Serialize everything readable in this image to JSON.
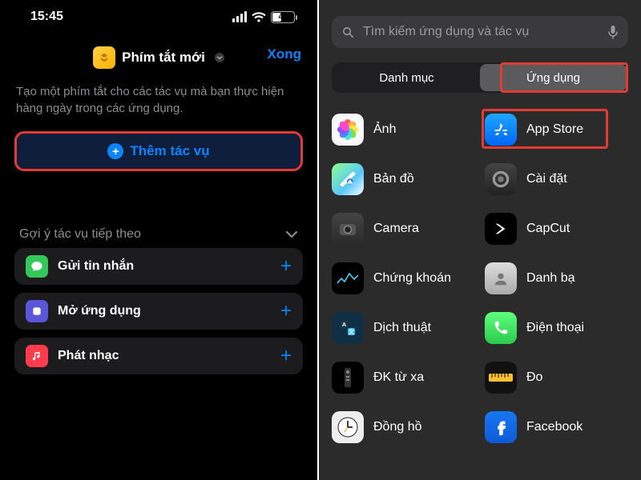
{
  "left": {
    "status": {
      "time": "15:45",
      "battery": "46"
    },
    "header": {
      "title": "Phím tắt mới",
      "done": "Xong"
    },
    "description": "Tạo một phím tắt cho các tác vụ mà bạn thực hiện hàng ngày trong các ứng dụng.",
    "add_action": "Thêm tác vụ",
    "suggestions_title": "Gợi ý tác vụ tiếp theo",
    "suggestions": [
      {
        "label": "Gửi tin nhắn"
      },
      {
        "label": "Mở ứng dụng"
      },
      {
        "label": "Phát nhạc"
      }
    ]
  },
  "right": {
    "search_placeholder": "Tìm kiếm ứng dụng và tác vụ",
    "segments": {
      "categories": "Danh mục",
      "apps": "Ứng dụng"
    },
    "apps": [
      {
        "name": "Ảnh"
      },
      {
        "name": "App Store"
      },
      {
        "name": "Bản đồ"
      },
      {
        "name": "Cài đặt"
      },
      {
        "name": "Camera"
      },
      {
        "name": "CapCut"
      },
      {
        "name": "Chứng khoán"
      },
      {
        "name": "Danh bạ"
      },
      {
        "name": "Dịch thuật"
      },
      {
        "name": "Điện thoại"
      },
      {
        "name": "ĐK từ xa"
      },
      {
        "name": "Đo"
      },
      {
        "name": "Đồng hồ"
      },
      {
        "name": "Facebook"
      }
    ]
  }
}
